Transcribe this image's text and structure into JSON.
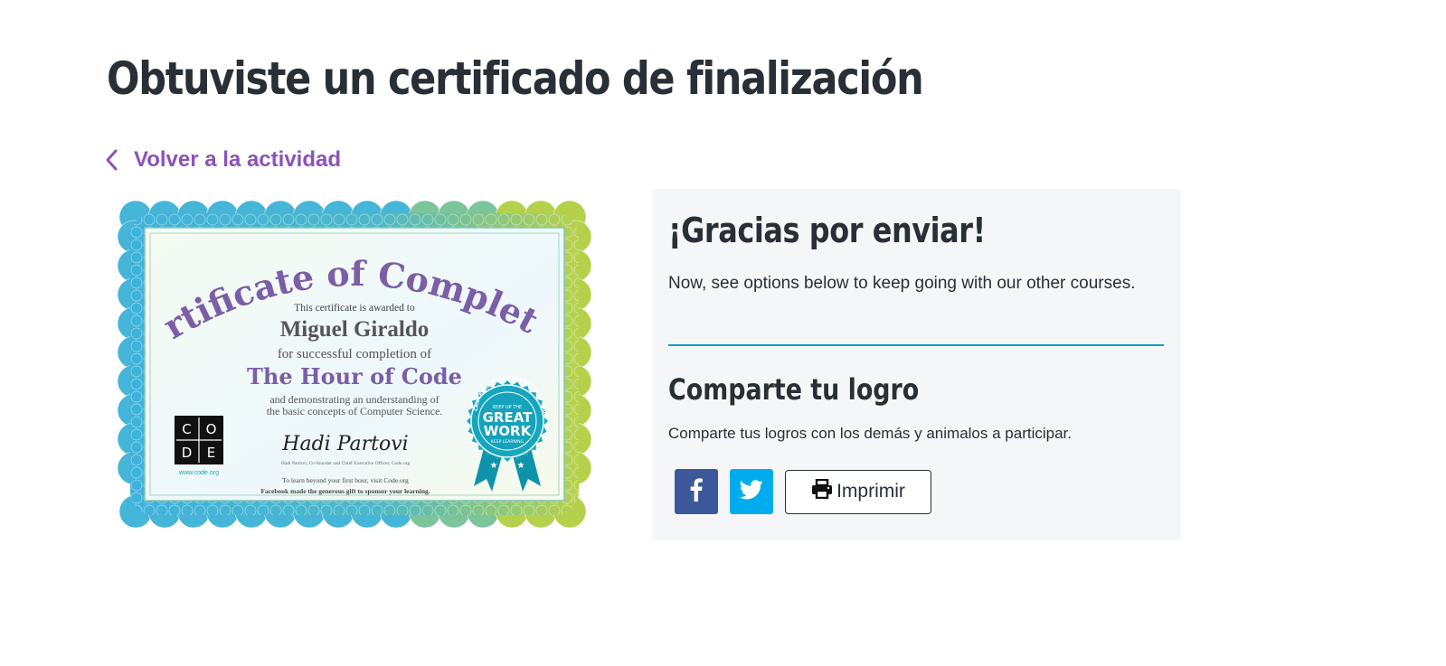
{
  "page": {
    "title": "Obtuviste un certificado de finalización",
    "back_link": "Volver a la actividad"
  },
  "certificate": {
    "heading": "Certificate of Completion",
    "awarded_to_line": "This certificate is awarded to",
    "recipient": "Miguel Giraldo",
    "completion_line": "for successful completion of",
    "course": "The Hour of Code",
    "understanding_line_1": "and demonstrating an understanding of",
    "understanding_line_2": "the basic concepts of Computer Science.",
    "signature": "Hadi Partovi",
    "signer_caption": "Hadi Partovi, Co-founder and Chief Executive Officer, Code.org",
    "footer_line_1": "To learn beyond your first hour, visit Code.org",
    "footer_line_2": "Facebook made the generous gift to sponsor your learning.",
    "logo_letters": [
      "C",
      "O",
      "D",
      "E"
    ],
    "logo_url": "www.code.org",
    "seal": {
      "arc_text": "ANYONE CAN LEARN COMPUTER SCIENCE • CODE.ORG •",
      "top_line": "KEEP UP THE",
      "line_1": "GREAT",
      "line_2": "WORK",
      "bottom_line": "KEEP LEARNING",
      "color": "#16a7c0"
    }
  },
  "thanks_panel": {
    "title": "¡Gracias por enviar!",
    "text": "Now, see options below to keep going with our other courses.",
    "share_title": "Comparte tu logro",
    "share_text": "Comparte tus logros con los demás y animalos a participar.",
    "print_label": "Imprimir",
    "facebook_icon": "facebook-icon",
    "twitter_icon": "twitter-icon",
    "print_icon": "printer-icon"
  },
  "colors": {
    "accent_purple": "#8c52ba",
    "divider_teal": "#0a9ec0",
    "facebook_blue": "#3b5998",
    "twitter_blue": "#00acee",
    "panel_bg": "#f5f6f8",
    "text_dark": "#292f36"
  }
}
